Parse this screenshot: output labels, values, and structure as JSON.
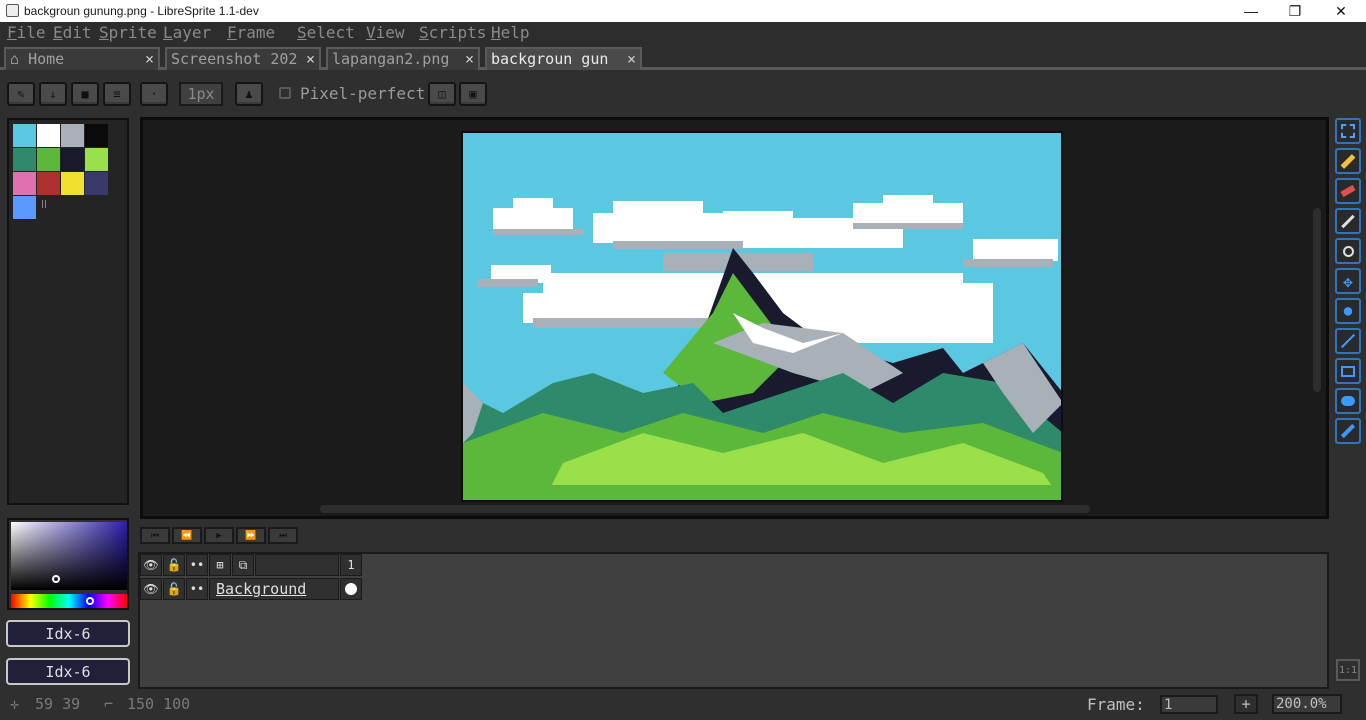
{
  "window": {
    "title": "backgroun gunung.png - LibreSprite 1.1-dev",
    "controls": [
      "—",
      "❐",
      "✕"
    ]
  },
  "menu": [
    {
      "label": "File",
      "u": "F",
      "rest": "ile"
    },
    {
      "label": "Edit",
      "u": "E",
      "rest": "dit"
    },
    {
      "label": "Sprite",
      "u": "S",
      "rest": "prite"
    },
    {
      "label": "Layer",
      "u": "L",
      "rest": "ayer"
    },
    {
      "label": "Frame",
      "u": "F",
      "rest": "rame"
    },
    {
      "label": "Select",
      "u": "S",
      "rest": "elect"
    },
    {
      "label": "View",
      "u": "V",
      "rest": "iew"
    },
    {
      "label": "Scripts",
      "u": "S",
      "rest": "cripts"
    },
    {
      "label": "Help",
      "u": "H",
      "rest": "elp"
    }
  ],
  "tabs": [
    {
      "label": "Home",
      "close": "×"
    },
    {
      "label": "Screenshot 202",
      "close": "×"
    },
    {
      "label": "lapangan2.png",
      "close": "×"
    },
    {
      "label": "backgroun gun",
      "close": "×"
    }
  ],
  "context": {
    "brush_size": "1px",
    "pixel_perfect_label": "Pixel-perfect",
    "pixel_perfect_checked": false
  },
  "palette": {
    "colors": [
      "#5bc8e2",
      "#ffffff",
      "#a8b0b8",
      "#0a0a0a",
      "#2e8a6a",
      "#5cb83a",
      "#1a1a2e",
      "#9ae04a",
      "#e070b0",
      "#b03030",
      "#f0e030",
      "#3a3a6a",
      "#5a9aff"
    ]
  },
  "color_picker": {
    "fg_label": "Idx-6",
    "bg_label": "Idx-6"
  },
  "layers": {
    "frame_number": "1",
    "rows": [
      {
        "name": "Background"
      }
    ]
  },
  "status": {
    "cursor_pos": "59 39",
    "sprite_size": "150 100",
    "frame_label": "Frame:",
    "frame_value": "1",
    "add_frame": "+",
    "zoom": "200.0%",
    "timeline_zoom": "1:1"
  }
}
